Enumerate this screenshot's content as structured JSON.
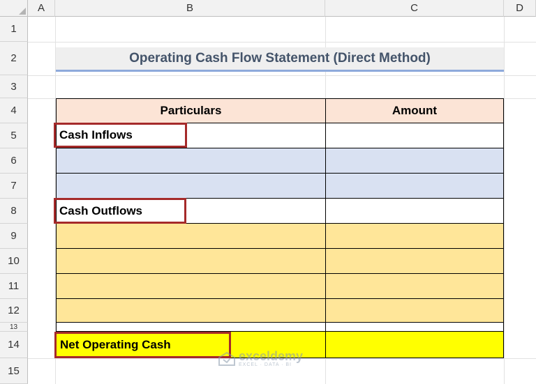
{
  "columns": [
    "A",
    "B",
    "C",
    "D"
  ],
  "rows": [
    "1",
    "2",
    "3",
    "4",
    "5",
    "6",
    "7",
    "8",
    "9",
    "10",
    "11",
    "12",
    "13",
    "14",
    "15"
  ],
  "title": "Operating Cash Flow Statement (Direct Method)",
  "table": {
    "header_particulars": "Particulars",
    "header_amount": "Amount",
    "cash_inflows": "Cash Inflows",
    "cash_outflows": "Cash Outflows",
    "net_operating_cash": "Net Operating Cash"
  },
  "colors": {
    "header_fill": "#fce4d6",
    "inflow_fill": "#d9e1f2",
    "outflow_fill": "#ffe699",
    "net_fill": "#ffff00",
    "highlight_box": "#a52a2a",
    "title_color": "#44546a"
  },
  "watermark": {
    "name": "exceldemy",
    "tagline": "EXCEL · DATA · BI"
  }
}
